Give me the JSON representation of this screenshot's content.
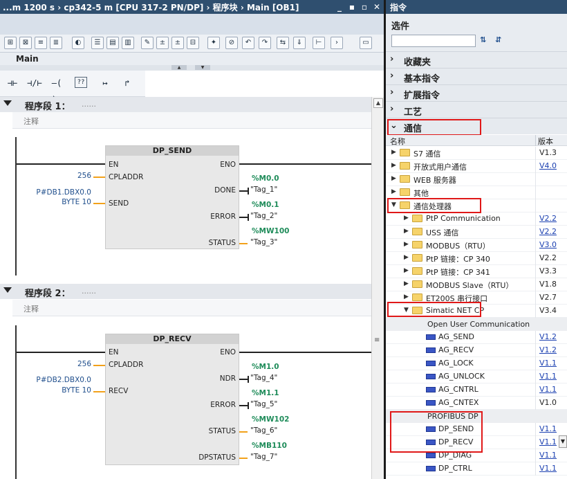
{
  "editor": {
    "title": "...m 1200 s  ›  cp342-5 m [CPU 317-2 PN/DP]  ›  程序块  ›  Main [OB1]",
    "win_min": "_",
    "win_max": "▪",
    "win_restore": "▫",
    "win_close": "✕",
    "block_name": "Main",
    "instr_nc": "⊣⊢",
    "instr_nc_neg": "⊣/⊢",
    "instr_coil": "–( )–",
    "instr_box": "??",
    "instr_branch_open": "↦",
    "instr_branch_close": "↱",
    "scroll_up": "▲",
    "scroll_down": "▼",
    "grip": "≡",
    "segments": [
      {
        "label": "程序段 1：",
        "dots": "......",
        "comment": "注释",
        "block": {
          "title": "DP_SEND",
          "in_pins": [
            "EN",
            "CPLADDR",
            "SEND"
          ],
          "out_pins": [
            "ENO",
            "DONE",
            "ERROR",
            "STATUS"
          ],
          "params": [
            "256",
            "P#DB1.DBX0.0",
            "BYTE 10"
          ],
          "outputs": [
            {
              "addr": "%M0.0",
              "tag": "\"Tag_1\""
            },
            {
              "addr": "%M0.1",
              "tag": "\"Tag_2\""
            },
            {
              "addr": "%MW100",
              "tag": "\"Tag_3\""
            }
          ]
        }
      },
      {
        "label": "程序段 2：",
        "dots": "......",
        "comment": "注释",
        "block": {
          "title": "DP_RECV",
          "in_pins": [
            "EN",
            "CPLADDR",
            "RECV"
          ],
          "out_pins": [
            "ENO",
            "NDR",
            "ERROR",
            "STATUS",
            "DPSTATUS"
          ],
          "params": [
            "256",
            "P#DB2.DBX0.0",
            "BYTE 10"
          ],
          "outputs": [
            {
              "addr": "%M1.0",
              "tag": "\"Tag_4\""
            },
            {
              "addr": "%M1.1",
              "tag": "\"Tag_5\""
            },
            {
              "addr": "%MW102",
              "tag": "\"Tag_6\""
            },
            {
              "addr": "%MB110",
              "tag": "\"Tag_7\""
            }
          ]
        }
      }
    ]
  },
  "panel": {
    "title": "指令",
    "options_label": "选件",
    "icon_a": "⇅",
    "icon_b": "⇵",
    "categories": [
      {
        "chev": "›",
        "label": "收藏夹"
      },
      {
        "chev": "›",
        "label": "基本指令"
      },
      {
        "chev": "›",
        "label": "扩展指令"
      },
      {
        "chev": "›",
        "label": "工艺"
      },
      {
        "chev": "⌄",
        "label": "通信"
      }
    ],
    "col_name": "名称",
    "col_version": "版本",
    "tree": [
      {
        "text": "S7 通信",
        "ver": "V1.3"
      },
      {
        "text": "开放式用户通信",
        "ver": "V4.0"
      },
      {
        "text": "WEB 服务器",
        "ver": ""
      },
      {
        "text": "其他",
        "ver": ""
      },
      {
        "text": "通信处理器",
        "ver": ""
      },
      {
        "text": "PtP Communication",
        "ver": "V2.2"
      },
      {
        "text": "USS 通信",
        "ver": "V2.2"
      },
      {
        "text": "MODBUS（RTU）",
        "ver": "V3.0"
      },
      {
        "text": "PtP 链接：CP 340",
        "ver": "V2.2"
      },
      {
        "text": "PtP 链接：CP 341",
        "ver": "V3.3"
      },
      {
        "text": "MODBUS Slave（RTU）",
        "ver": "V1.8"
      },
      {
        "text": "ET200S 串行接口",
        "ver": "V2.7"
      },
      {
        "text": "Simatic NET CP",
        "ver": "V3.4"
      }
    ],
    "group_ouc": "Open User Communication",
    "ouc_items": [
      {
        "text": "AG_SEND",
        "ver": "V1.2"
      },
      {
        "text": "AG_RECV",
        "ver": "V1.2"
      },
      {
        "text": "AG_LOCK",
        "ver": "V1.1"
      },
      {
        "text": "AG_UNLOCK",
        "ver": "V1.1"
      },
      {
        "text": "AG_CNTRL",
        "ver": "V1.1"
      },
      {
        "text": "AG_CNTEX",
        "ver": "V1.0"
      }
    ],
    "group_dp": "PROFIBUS DP",
    "dp_items": [
      {
        "text": "DP_SEND",
        "ver": "V1.1"
      },
      {
        "text": "DP_RECV",
        "ver": "V1.1"
      },
      {
        "text": "DP_DIAG",
        "ver": "V1.1"
      },
      {
        "text": "DP_CTRL",
        "ver": "V1.1"
      }
    ],
    "dropdown_arrow": "▼"
  }
}
